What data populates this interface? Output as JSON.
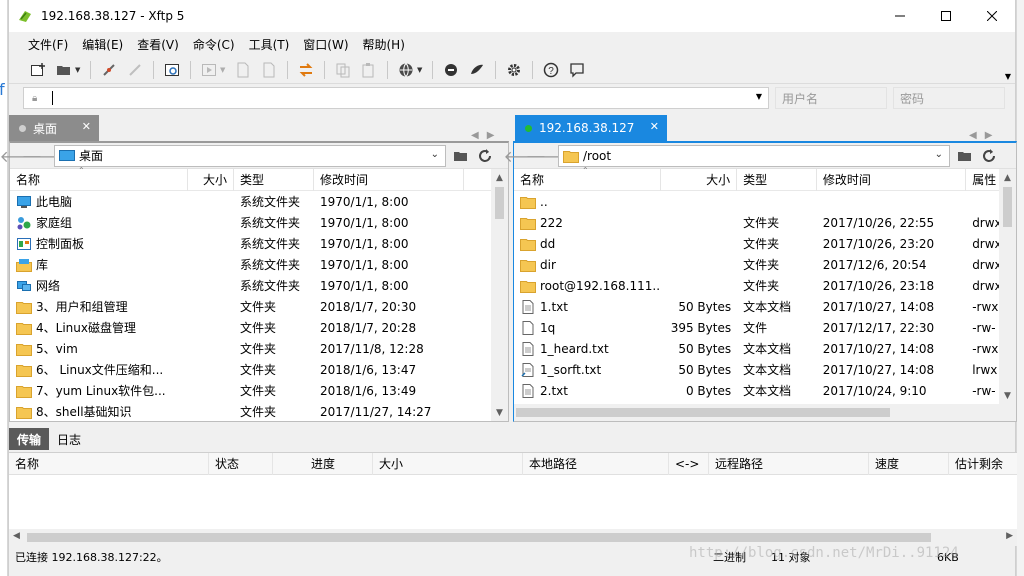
{
  "window": {
    "title": "192.168.38.127   - Xftp 5",
    "controls": [
      "minimize",
      "maximize",
      "close"
    ]
  },
  "menu": [
    "文件(F)",
    "编辑(E)",
    "查看(V)",
    "命令(C)",
    "工具(T)",
    "窗口(W)",
    "帮助(H)"
  ],
  "address": {
    "value": "",
    "username_placeholder": "用户名",
    "password_placeholder": "密码"
  },
  "tabs": {
    "left": {
      "label": "桌面"
    },
    "right": {
      "label": "192.168.38.127"
    }
  },
  "left_pane": {
    "path": "桌面",
    "columns": [
      "名称",
      "大小",
      "类型",
      "修改时间"
    ],
    "rows": [
      {
        "name": "此电脑",
        "size": "",
        "type": "系统文件夹",
        "modified": "1970/1/1, 8:00",
        "icon": "pc-icon"
      },
      {
        "name": "家庭组",
        "size": "",
        "type": "系统文件夹",
        "modified": "1970/1/1, 8:00",
        "icon": "homegroup-icon"
      },
      {
        "name": "控制面板",
        "size": "",
        "type": "系统文件夹",
        "modified": "1970/1/1, 8:00",
        "icon": "control-panel-icon"
      },
      {
        "name": "库",
        "size": "",
        "type": "系统文件夹",
        "modified": "1970/1/1, 8:00",
        "icon": "library-icon"
      },
      {
        "name": "网络",
        "size": "",
        "type": "系统文件夹",
        "modified": "1970/1/1, 8:00",
        "icon": "network-icon"
      },
      {
        "name": "3、用户和组管理",
        "size": "",
        "type": "文件夹",
        "modified": "2018/1/7, 20:30",
        "icon": "folder-icon"
      },
      {
        "name": "4、Linux磁盘管理",
        "size": "",
        "type": "文件夹",
        "modified": "2018/1/7, 20:28",
        "icon": "folder-icon"
      },
      {
        "name": "5、vim",
        "size": "",
        "type": "文件夹",
        "modified": "2017/11/8, 12:28",
        "icon": "folder-icon"
      },
      {
        "name": "6、 Linux文件压缩和...",
        "size": "",
        "type": "文件夹",
        "modified": "2018/1/6, 13:47",
        "icon": "folder-icon"
      },
      {
        "name": "7、yum Linux软件包...",
        "size": "",
        "type": "文件夹",
        "modified": "2018/1/6, 13:49",
        "icon": "folder-icon"
      },
      {
        "name": "8、shell基础知识",
        "size": "",
        "type": "文件夹",
        "modified": "2017/11/27, 14:27",
        "icon": "folder-icon"
      }
    ]
  },
  "right_pane": {
    "path": "/root",
    "columns": [
      "名称",
      "大小",
      "类型",
      "修改时间",
      "属性"
    ],
    "rows": [
      {
        "name": "..",
        "size": "",
        "type": "",
        "modified": "",
        "attr": "",
        "icon": "folder-icon"
      },
      {
        "name": "222",
        "size": "",
        "type": "文件夹",
        "modified": "2017/10/26, 22:55",
        "attr": "drwx",
        "icon": "folder-icon"
      },
      {
        "name": "dd",
        "size": "",
        "type": "文件夹",
        "modified": "2017/10/26, 23:20",
        "attr": "drwx",
        "icon": "folder-icon"
      },
      {
        "name": "dir",
        "size": "",
        "type": "文件夹",
        "modified": "2017/12/6, 20:54",
        "attr": "drwx",
        "icon": "folder-icon"
      },
      {
        "name": "root@192.168.111....",
        "size": "",
        "type": "文件夹",
        "modified": "2017/10/26, 23:18",
        "attr": "drwx",
        "icon": "folder-icon"
      },
      {
        "name": "1.txt",
        "size": "50 Bytes",
        "type": "文本文档",
        "modified": "2017/10/27, 14:08",
        "attr": "-rwx",
        "icon": "text-file-icon"
      },
      {
        "name": "1q",
        "size": "395 Bytes",
        "type": "文件",
        "modified": "2017/12/17, 22:30",
        "attr": "-rw-",
        "icon": "file-icon"
      },
      {
        "name": "1_heard.txt",
        "size": "50 Bytes",
        "type": "文本文档",
        "modified": "2017/10/27, 14:08",
        "attr": "-rwx",
        "icon": "text-file-icon"
      },
      {
        "name": "1_sorft.txt",
        "size": "50 Bytes",
        "type": "文本文档",
        "modified": "2017/10/27, 14:08",
        "attr": "lrwx",
        "icon": "link-file-icon"
      },
      {
        "name": "2.txt",
        "size": "0 Bytes",
        "type": "文本文档",
        "modified": "2017/10/24, 9:10",
        "attr": "-rw-",
        "icon": "text-file-icon"
      }
    ]
  },
  "transfer": {
    "tabs": [
      "传输",
      "日志"
    ],
    "columns": [
      "名称",
      "状态",
      "进度",
      "大小",
      "本地路径",
      "<->",
      "远程路径",
      "速度",
      "估计剩余"
    ]
  },
  "status": {
    "connection": "已连接 192.168.38.127:22。",
    "mode": "二进制",
    "objects": "11 对象",
    "size": "6KB"
  },
  "watermark": "http://blog.csdn.net/MrDi..91124",
  "colors": {
    "accent": "#1a88e0",
    "folder": "#f5c652",
    "inactive_tab": "#8c8c8c",
    "connected_dot": "#22bb33"
  }
}
